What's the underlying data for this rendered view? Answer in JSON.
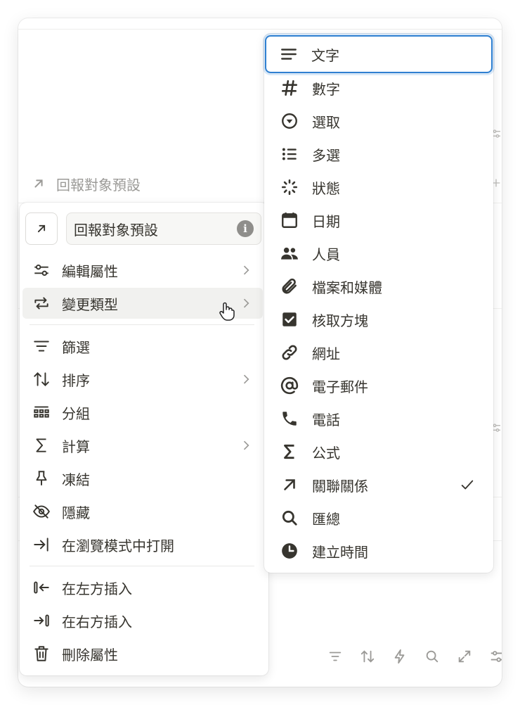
{
  "background": {
    "header_label": "回報對象預設",
    "header_icon": "arrow-up-right-icon"
  },
  "property_menu": {
    "type_icon": "arrow-up-right-icon",
    "name_value": "回報對象預設",
    "items": [
      {
        "label": "編輯屬性",
        "icon": "sliders-icon",
        "has_submenu": true
      },
      {
        "label": "變更類型",
        "icon": "change-type-icon",
        "has_submenu": true,
        "hovered": true
      },
      {
        "label": "篩選",
        "icon": "filter-icon",
        "has_submenu": false
      },
      {
        "label": "排序",
        "icon": "sort-icon",
        "has_submenu": true
      },
      {
        "label": "分組",
        "icon": "group-icon",
        "has_submenu": false
      },
      {
        "label": "計算",
        "icon": "sigma-icon",
        "has_submenu": true
      },
      {
        "label": "凍結",
        "icon": "pin-icon",
        "has_submenu": false
      },
      {
        "label": "隱藏",
        "icon": "eye-off-icon",
        "has_submenu": false
      },
      {
        "label": "在瀏覽模式中打開",
        "icon": "open-browse-icon",
        "has_submenu": false
      },
      {
        "label": "在左方插入",
        "icon": "insert-left-icon",
        "has_submenu": false
      },
      {
        "label": "在右方插入",
        "icon": "insert-right-icon",
        "has_submenu": false
      },
      {
        "label": "刪除屬性",
        "icon": "trash-icon",
        "has_submenu": false
      }
    ]
  },
  "type_menu": {
    "items": [
      {
        "label": "文字",
        "icon": "text-icon",
        "selected_focus": true
      },
      {
        "label": "數字",
        "icon": "hash-icon"
      },
      {
        "label": "選取",
        "icon": "select-icon"
      },
      {
        "label": "多選",
        "icon": "list-icon"
      },
      {
        "label": "狀態",
        "icon": "status-icon"
      },
      {
        "label": "日期",
        "icon": "calendar-icon"
      },
      {
        "label": "人員",
        "icon": "people-icon"
      },
      {
        "label": "檔案和媒體",
        "icon": "paperclip-icon"
      },
      {
        "label": "核取方塊",
        "icon": "checkbox-icon"
      },
      {
        "label": "網址",
        "icon": "link-icon"
      },
      {
        "label": "電子郵件",
        "icon": "at-icon"
      },
      {
        "label": "電話",
        "icon": "phone-icon"
      },
      {
        "label": "公式",
        "icon": "sigma-icon"
      },
      {
        "label": "關聯關係",
        "icon": "arrow-up-right-icon",
        "checked": true
      },
      {
        "label": "匯總",
        "icon": "search-icon"
      },
      {
        "label": "建立時間",
        "icon": "clock-icon"
      }
    ]
  },
  "bottom_toolbar": [
    "filter-icon",
    "sort-icon",
    "lightning-icon",
    "search-icon",
    "expand-icon",
    "sliders-icon"
  ],
  "colors": {
    "focus_ring": "#2f80d1",
    "hover_bg": "#f1f1ef",
    "text": "#37352f",
    "muted": "#9b9a97"
  }
}
